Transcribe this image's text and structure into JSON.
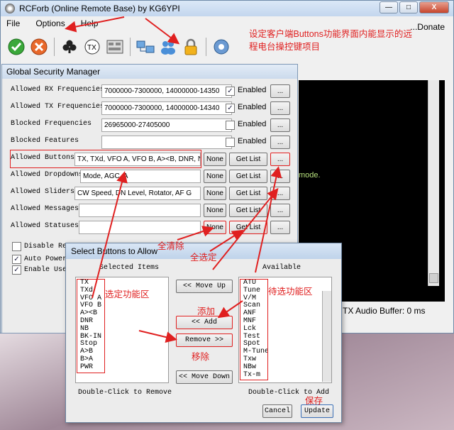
{
  "window": {
    "title": "RCForb (Online Remote Base) by KG6YPI",
    "controls": [
      "—",
      "□",
      "X"
    ]
  },
  "menu": {
    "items": [
      "File",
      "Options",
      "Help"
    ],
    "donate": "...Donate"
  },
  "annotations": {
    "top": "设定客户端Buttons功能界面内能显示的远程电台操控键项目",
    "clear_all": "全清除",
    "select_all": "全选定",
    "selected_area": "选定功能区",
    "available_area": "待选功能区",
    "add": "添加",
    "remove": "移除",
    "save": "保存"
  },
  "console": {
    "message": "mode.",
    "tx_buffer": "TX Audio Buffer: 0 ms"
  },
  "gsm": {
    "title": "Global Security Manager",
    "enabled_label": "Enabled",
    "dots_label": "...",
    "none_label": "None",
    "getlist_label": "Get List",
    "rows": [
      {
        "label": "Allowed RX Frequencies",
        "value": "7000000-7300000, 14000000-14350",
        "enabled": true
      },
      {
        "label": "Allowed TX Frequencies",
        "value": "7000000-7300000, 14000000-14340",
        "enabled": true
      },
      {
        "label": "Blocked Frequencies",
        "value": "26965000-27405000",
        "enabled": false
      },
      {
        "label": "Blocked Features",
        "value": "",
        "enabled": false
      },
      {
        "label": "Allowed Buttons",
        "value": "TX, TXd, VFO A, VFO B, A><B, DNR, NB, B"
      },
      {
        "label": "Allowed Dropdowns",
        "value": "Mode, AGC, A"
      },
      {
        "label": "Allowed Sliders",
        "value": "CW Speed, DN  Level, Rotator, AF G"
      },
      {
        "label": "Allowed Messages",
        "value": ""
      },
      {
        "label": "Allowed Statuses",
        "value": ""
      }
    ],
    "bottom_options": [
      {
        "label": "Disable Rem",
        "checked": false
      },
      {
        "label": "Auto Power",
        "checked": true
      },
      {
        "label": "Enable User",
        "checked": true
      }
    ]
  },
  "dialog": {
    "title": "Select Buttons to Allow",
    "selected_header": "Selected Items",
    "available_header": "Available",
    "selected_items": [
      "TX",
      "TXd",
      "VFO A",
      "VFO B",
      "A><B",
      "DNR",
      "NB",
      "BK-IN",
      "Stop",
      "A>B",
      "B>A",
      "PWR"
    ],
    "available_items": [
      "ATU",
      "Tune",
      "V/M",
      "Scan",
      "ANF",
      "MNF",
      "Lck",
      "Test",
      "Spot",
      "M-Tune",
      "Txw",
      "NBw",
      "Tx-m"
    ],
    "buttons": {
      "move_up": "<< Move Up",
      "add": "<< Add",
      "remove": "Remove >>",
      "move_down": "<< Move Down",
      "cancel": "Cancel",
      "update": "Update"
    },
    "hint_remove": "Double-Click to Remove",
    "hint_add": "Double-Click to Add"
  },
  "colors": {
    "annotation": "#e02020",
    "console_bg": "#000000",
    "console_text": "#b6e07c"
  }
}
